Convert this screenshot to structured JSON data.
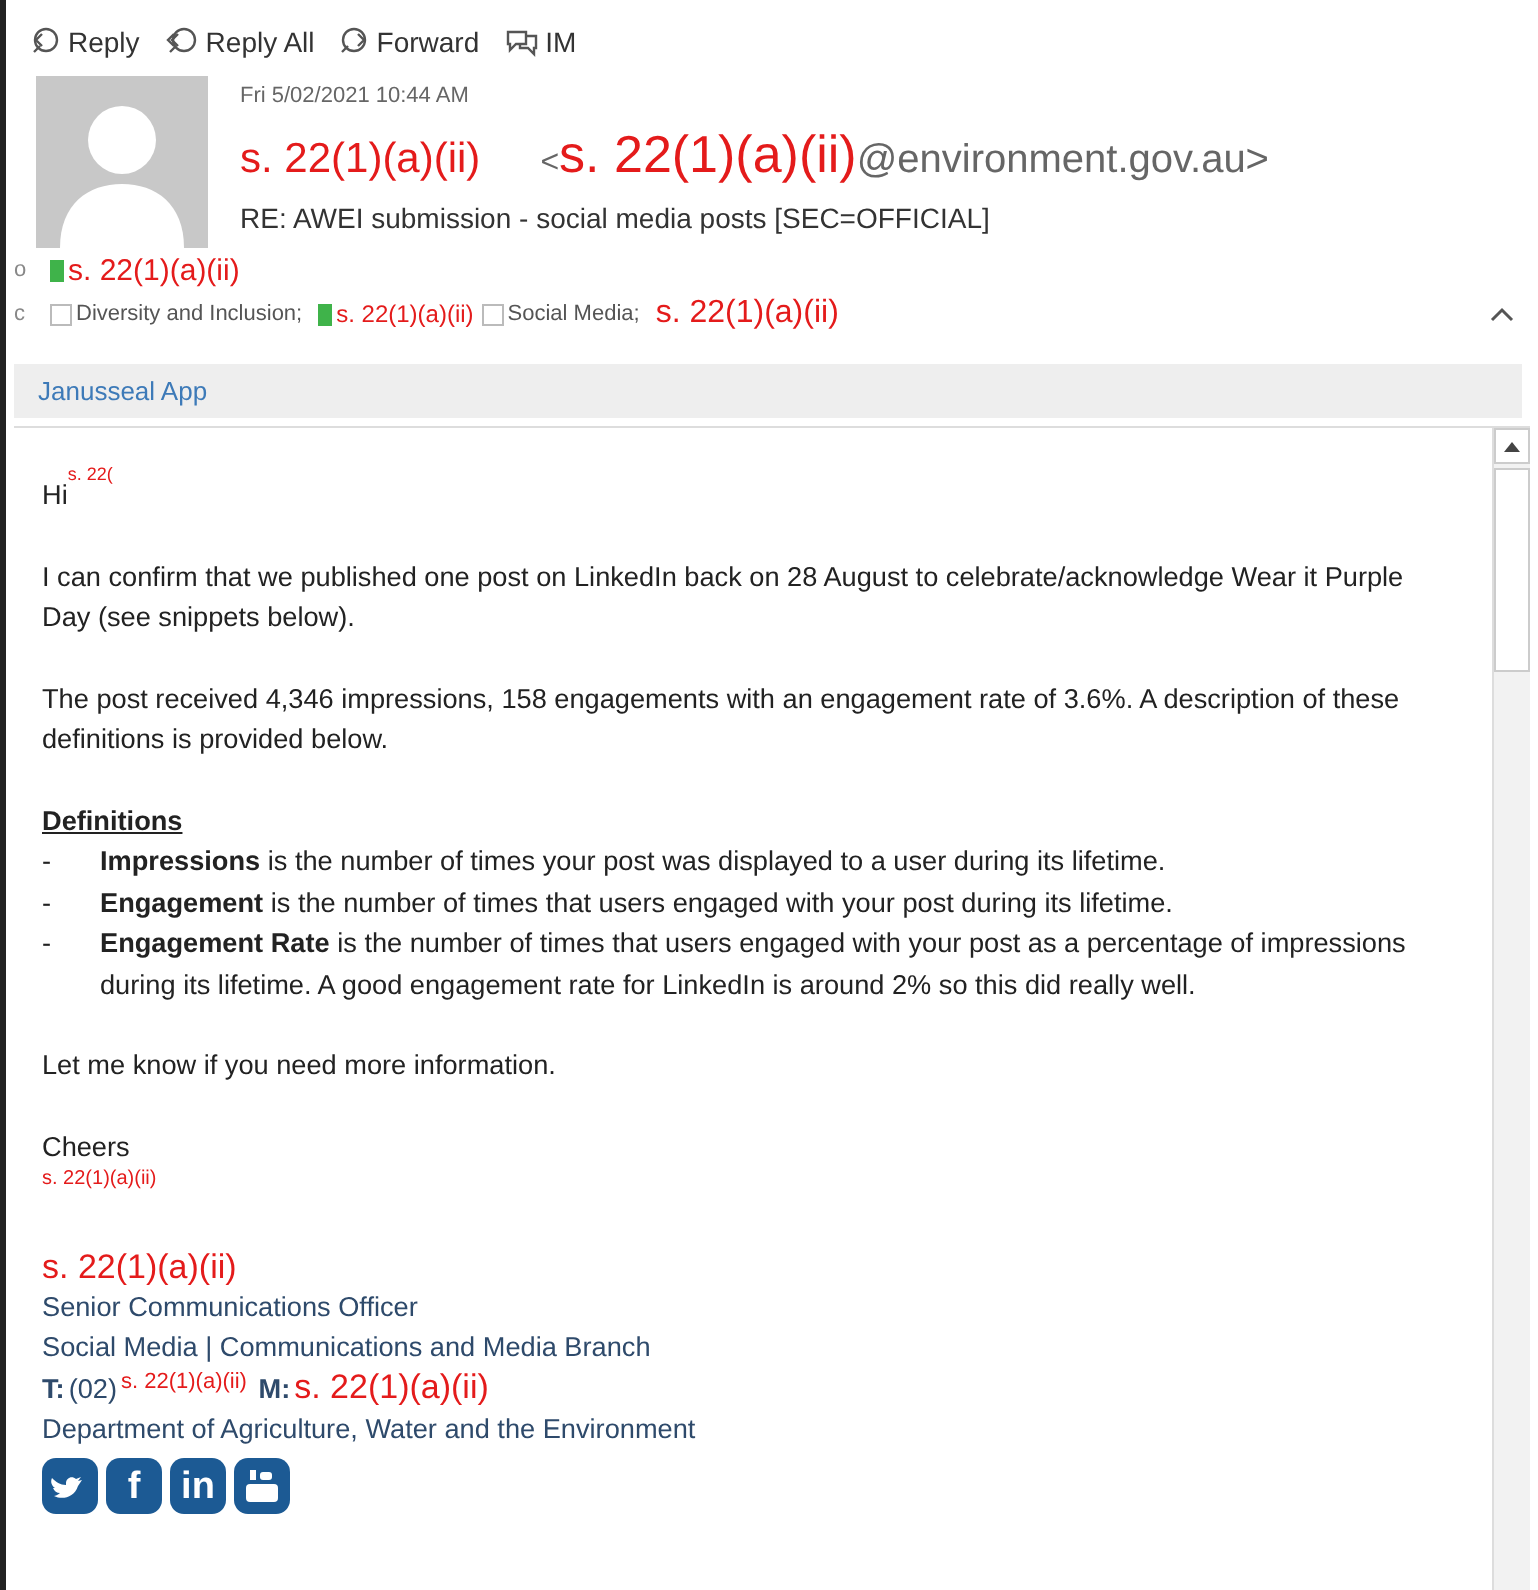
{
  "toolbar": [
    {
      "kind": "reply",
      "label": "Reply"
    },
    {
      "kind": "reply_all",
      "label": "Reply All"
    },
    {
      "kind": "forward",
      "label": "Forward"
    },
    {
      "kind": "im",
      "label": "IM"
    }
  ],
  "message": {
    "date": "Fri 5/02/2021 10:44 AM",
    "sender_name": "s. 22(1)(a)(ii)",
    "address_open": "<",
    "address_redaction": "s. 22(1)(a)(ii)",
    "address_domain": "@environment.gov.au>",
    "subject": "RE: AWEI submission - social media posts [SEC=OFFICIAL]"
  },
  "to": {
    "label": "o",
    "recipients": [
      {
        "kind": "person",
        "name": "s. 22(1)(a)(ii)"
      }
    ]
  },
  "cc": {
    "label": "c",
    "recipients": [
      {
        "kind": "group",
        "name": "Diversity and Inclusion;"
      },
      {
        "kind": "person_small",
        "name": "s. 22(1)(a)(ii)"
      },
      {
        "kind": "group",
        "name": "Social Media;"
      },
      {
        "kind": "redaction",
        "name": "s. 22(1)(a)(ii)"
      }
    ]
  },
  "app_bar": {
    "label": "Janusseal App"
  },
  "body": [
    {
      "kind": "greeting",
      "text": "Hi",
      "redaction": "s. 22("
    },
    {
      "kind": "paragraph",
      "text": "I can confirm that we published one post on LinkedIn back on 28 August to celebrate/acknowledge Wear it Purple Day (see snippets below)."
    },
    {
      "kind": "paragraph",
      "text": "The post received 4,346 impressions, 158 engagements with an engagement rate of 3.6%. A description of these definitions is provided below."
    },
    {
      "kind": "heading",
      "text": "Definitions"
    },
    {
      "kind": "bullet",
      "marker": "-",
      "text": "**Impressions** is the number of times your post was displayed to a user during its lifetime."
    },
    {
      "kind": "bullet",
      "marker": "-",
      "text": "**Engagement** is the number of times that users engaged with your post during its lifetime."
    },
    {
      "kind": "bullet",
      "marker": "-",
      "text": "**Engagement Rate** is the number of times that users engaged with your post as a percentage of impressions during its lifetime. A good engagement rate for LinkedIn is around 2% so this did really well."
    },
    {
      "kind": "paragraph",
      "text": "Let me know if you need more information."
    },
    {
      "kind": "closing",
      "text": "Cheers"
    },
    {
      "kind": "redaction_small",
      "text": "s. 22(1)(a)(ii)"
    }
  ],
  "signature": {
    "name": "s. 22(1)(a)(ii)",
    "title": "Senior Communications Officer",
    "unit": "Social Media | Communications and Media Branch",
    "phone_label": "T:",
    "phone_prefix": "(02)",
    "phone_redaction": "s. 22(1)(a)(ii)",
    "mobile_label": "M:",
    "mobile_redaction": "s. 22(1)(a)(ii)",
    "department": "Department of Agriculture, Water and the Environment",
    "social": [
      {
        "kind": "twitter"
      },
      {
        "kind": "facebook",
        "label": "f"
      },
      {
        "kind": "linkedin",
        "label": "in"
      },
      {
        "kind": "youtube"
      }
    ]
  }
}
